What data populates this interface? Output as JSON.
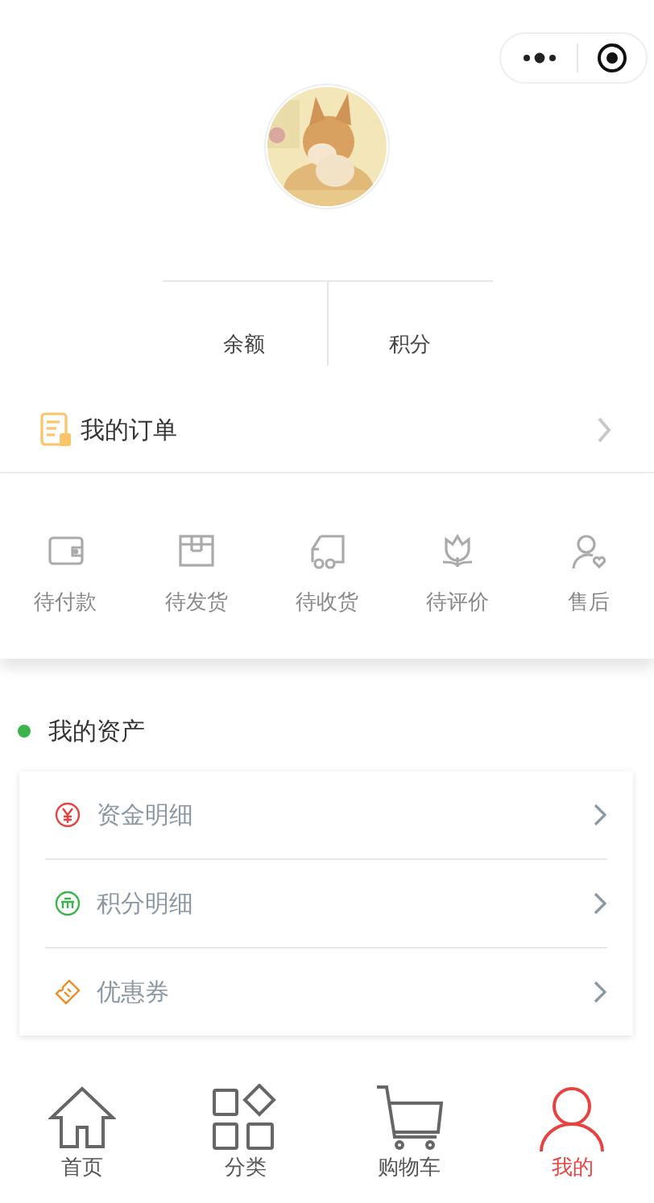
{
  "stats": [
    {
      "label": "余额"
    },
    {
      "label": "积分"
    }
  ],
  "orders": {
    "title": "我的订单",
    "items": [
      {
        "label": "待付款",
        "kind": "wallet"
      },
      {
        "label": "待发货",
        "kind": "box"
      },
      {
        "label": "待收货",
        "kind": "truck"
      },
      {
        "label": "待评价",
        "kind": "flower"
      },
      {
        "label": "售后",
        "kind": "service"
      }
    ]
  },
  "assets": {
    "title": "我的资产",
    "items": [
      {
        "label": "资金明细",
        "kind": "money",
        "color": "#e64340"
      },
      {
        "label": "积分明细",
        "kind": "coin",
        "color": "#3cb44b"
      },
      {
        "label": "优惠券",
        "kind": "coupon",
        "color": "#f08a24"
      }
    ]
  },
  "tabbar": [
    {
      "label": "首页",
      "kind": "home",
      "selected": false
    },
    {
      "label": "分类",
      "kind": "category",
      "selected": false
    },
    {
      "label": "购物车",
      "kind": "cart",
      "selected": false
    },
    {
      "label": "我的",
      "kind": "user",
      "selected": true
    }
  ]
}
